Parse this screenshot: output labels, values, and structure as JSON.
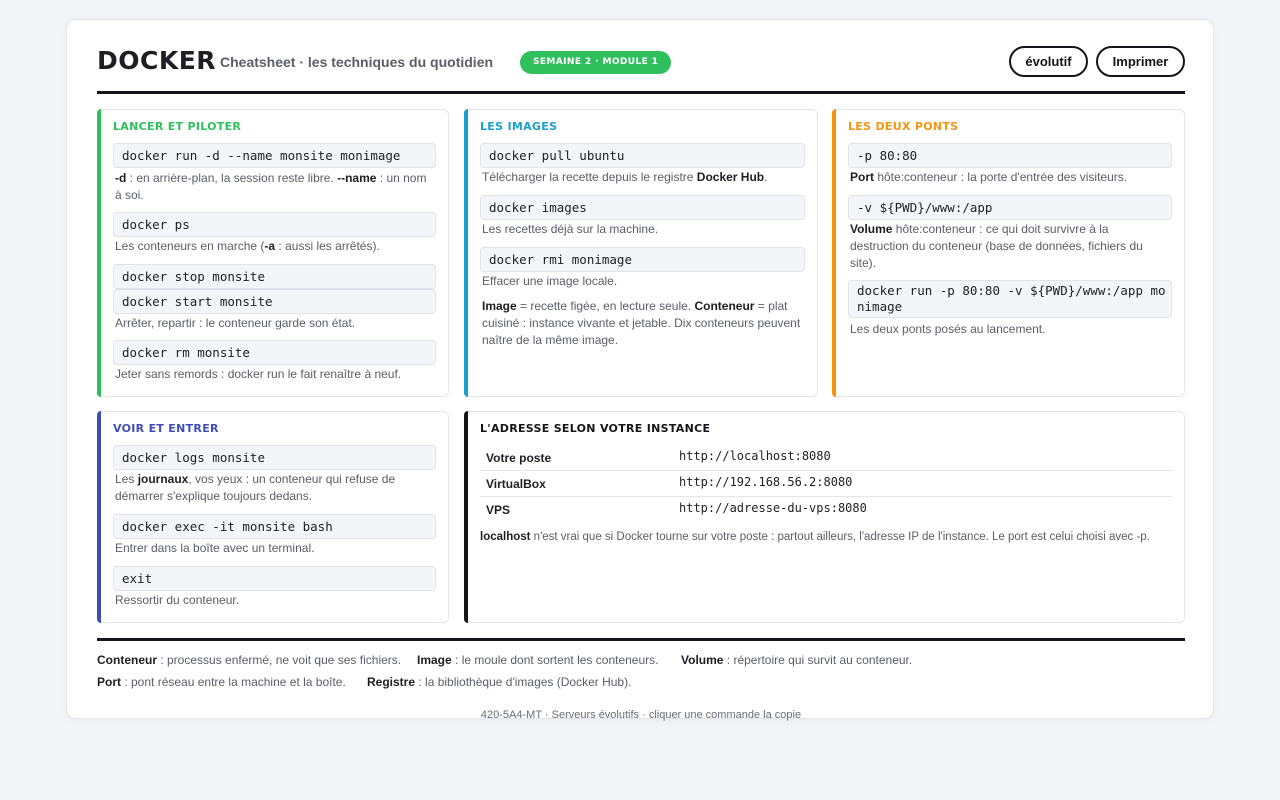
{
  "header": {
    "brand": "Docker",
    "subtitle": "Cheatsheet · les techniques du quotidien",
    "badge": "Semaine 2 · Module 1",
    "btn_evolutif": "évolutif",
    "btn_print": "Imprimer"
  },
  "cards": {
    "lancer": {
      "title": "Lancer et piloter",
      "cmd1": "docker run -d --name monsite monimage",
      "d1_k1": "-d",
      "d1_t1": " : en arrière-plan, la session reste libre. ",
      "d1_k2": "--name",
      "d1_t2": " : un nom à soi.",
      "cmd2": "docker ps",
      "d2_t1": "Les conteneurs en marche (",
      "d2_k1": "-a",
      "d2_t2": " : aussi les arrêtés).",
      "cmd3": "docker stop monsite",
      "cmd4": "docker start monsite",
      "d3": "Arrêter, repartir : le conteneur garde son état.",
      "cmd5": "docker rm monsite",
      "d4": "Jeter sans remords : docker run le fait renaître à neuf."
    },
    "images": {
      "title": "Les images",
      "cmd1": "docker pull ubuntu",
      "d1_t1": "Télécharger la recette depuis le registre ",
      "d1_k1": "Docker Hub",
      "d1_t2": ".",
      "cmd2": "docker images",
      "d2": "Les recettes déjà sur la machine.",
      "cmd3": "docker rmi monimage",
      "d3": "Effacer une image locale.",
      "note_k1": "Image",
      "note_t1": " = recette figée, en lecture seule. ",
      "note_k2": "Conteneur",
      "note_t2": " = plat cuisiné : instance vivante et jetable. Dix conteneurs peuvent naître de la même image."
    },
    "ponts": {
      "title": "Les deux ponts",
      "cmd1": "-p 80:80",
      "d1_k1": "Port",
      "d1_t1": " hôte:conteneur : la porte d'entrée des visiteurs.",
      "cmd2": "-v ${PWD}/www:/app",
      "d2_k1": "Volume",
      "d2_t1": " hôte:conteneur : ce qui doit survivre à la destruction du conteneur (base de données, fichiers du site).",
      "cmd3": "docker run -p 80:80 -v ${PWD}/www:/app monimage",
      "d3": "Les deux ponts posés au lancement."
    },
    "voir": {
      "title": "Voir et entrer",
      "cmd1": "docker logs monsite",
      "d1_t1": "Les ",
      "d1_k1": "journaux",
      "d1_t2": ", vos yeux : un conteneur qui refuse de démarrer s'explique toujours dedans.",
      "cmd2": "docker exec -it monsite bash",
      "d2": "Entrer dans la boîte avec un terminal.",
      "cmd3": "exit",
      "d3": "Ressortir du conteneur."
    },
    "adresse": {
      "title": "L'adresse selon votre instance",
      "rows": [
        {
          "label": "Votre poste",
          "url": "http://localhost:8080"
        },
        {
          "label": "VirtualBox",
          "url": "http://192.168.56.2:8080"
        },
        {
          "label": "VPS",
          "url": "http://adresse-du-vps:8080"
        }
      ],
      "note_k1": "localhost",
      "note_t1": " n'est vrai que si Docker tourne sur votre poste : partout ailleurs, l'adresse IP de l'instance. Le port est celui choisi avec -p."
    }
  },
  "glossary": [
    {
      "term": "Conteneur",
      "def": " : processus enfermé, ne voit que ses fichiers."
    },
    {
      "term": "Image",
      "def": " : le moule dont sortent les conteneurs."
    },
    {
      "term": "Volume",
      "def": " : répertoire qui survit au conteneur."
    },
    {
      "term": "Port",
      "def": " : pont réseau entre la machine et la boîte."
    },
    {
      "term": "Registre",
      "def": " : la bibliothèque d'images (Docker Hub)."
    }
  ],
  "footer": {
    "credit": "420-5A4-MT · Serveurs évolutifs · cliquer une commande la copie"
  },
  "colors": {
    "green": "#2fc05d",
    "blue": "#1aa0d0",
    "orange": "#f5950f",
    "indigo": "#3f4db8",
    "black": "#15151a"
  }
}
